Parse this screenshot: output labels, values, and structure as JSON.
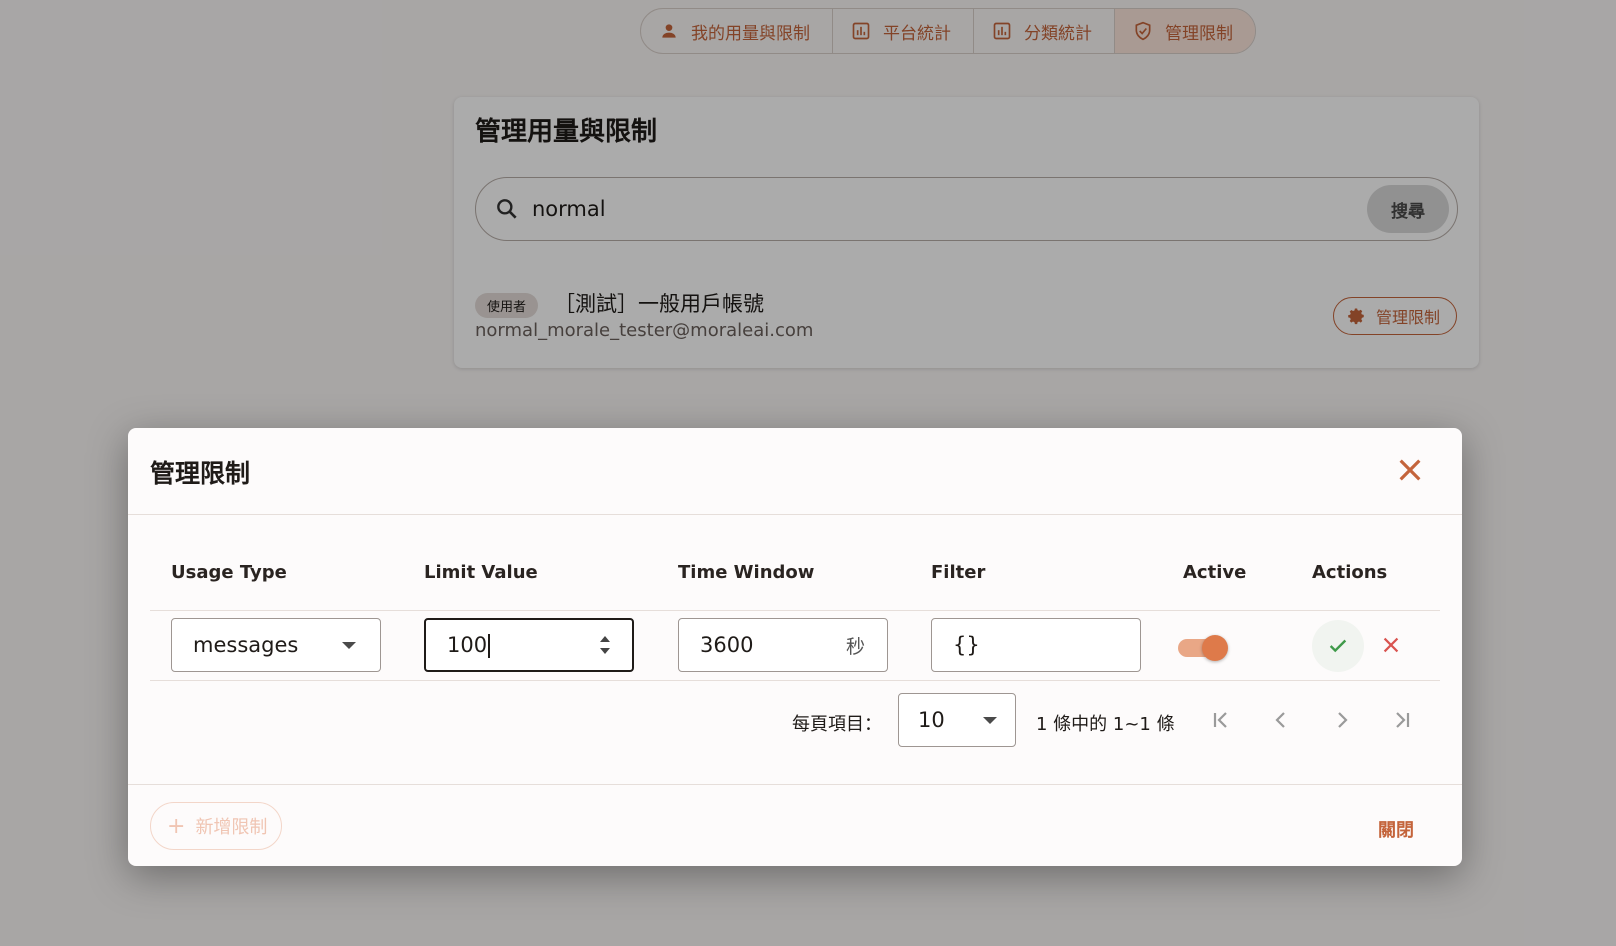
{
  "tabs": [
    {
      "label": "我的用量與限制",
      "icon": "person-icon"
    },
    {
      "label": "平台統計",
      "icon": "bar-chart-icon"
    },
    {
      "label": "分類統計",
      "icon": "bar-chart-icon"
    },
    {
      "label": "管理限制",
      "icon": "shield-check-icon"
    }
  ],
  "card": {
    "title": "管理用量與限制",
    "search_value": "normal",
    "search_button": "搜尋",
    "user": {
      "role_chip": "使用者",
      "name": "［測試］一般用戶帳號",
      "email": "normal_morale_tester@moraleai.com",
      "manage_button": "管理限制"
    }
  },
  "dialog": {
    "title": "管理限制",
    "columns": [
      "Usage Type",
      "Limit Value",
      "Time Window",
      "Filter",
      "Active",
      "Actions"
    ],
    "row": {
      "usage_type": "messages",
      "limit_value": "100",
      "time_window": "3600",
      "time_unit": "秒",
      "filter": "{}",
      "active": true
    },
    "pagination": {
      "per_page_label": "每頁項目：",
      "per_page_value": "10",
      "range_text": "1 條中的 1~1 條"
    },
    "add_button": "新增限制",
    "close_button": "關閉"
  },
  "colors": {
    "accent": "#c4643b",
    "toggle_thumb": "#de7a4a",
    "save_check": "#3f9a4a"
  }
}
